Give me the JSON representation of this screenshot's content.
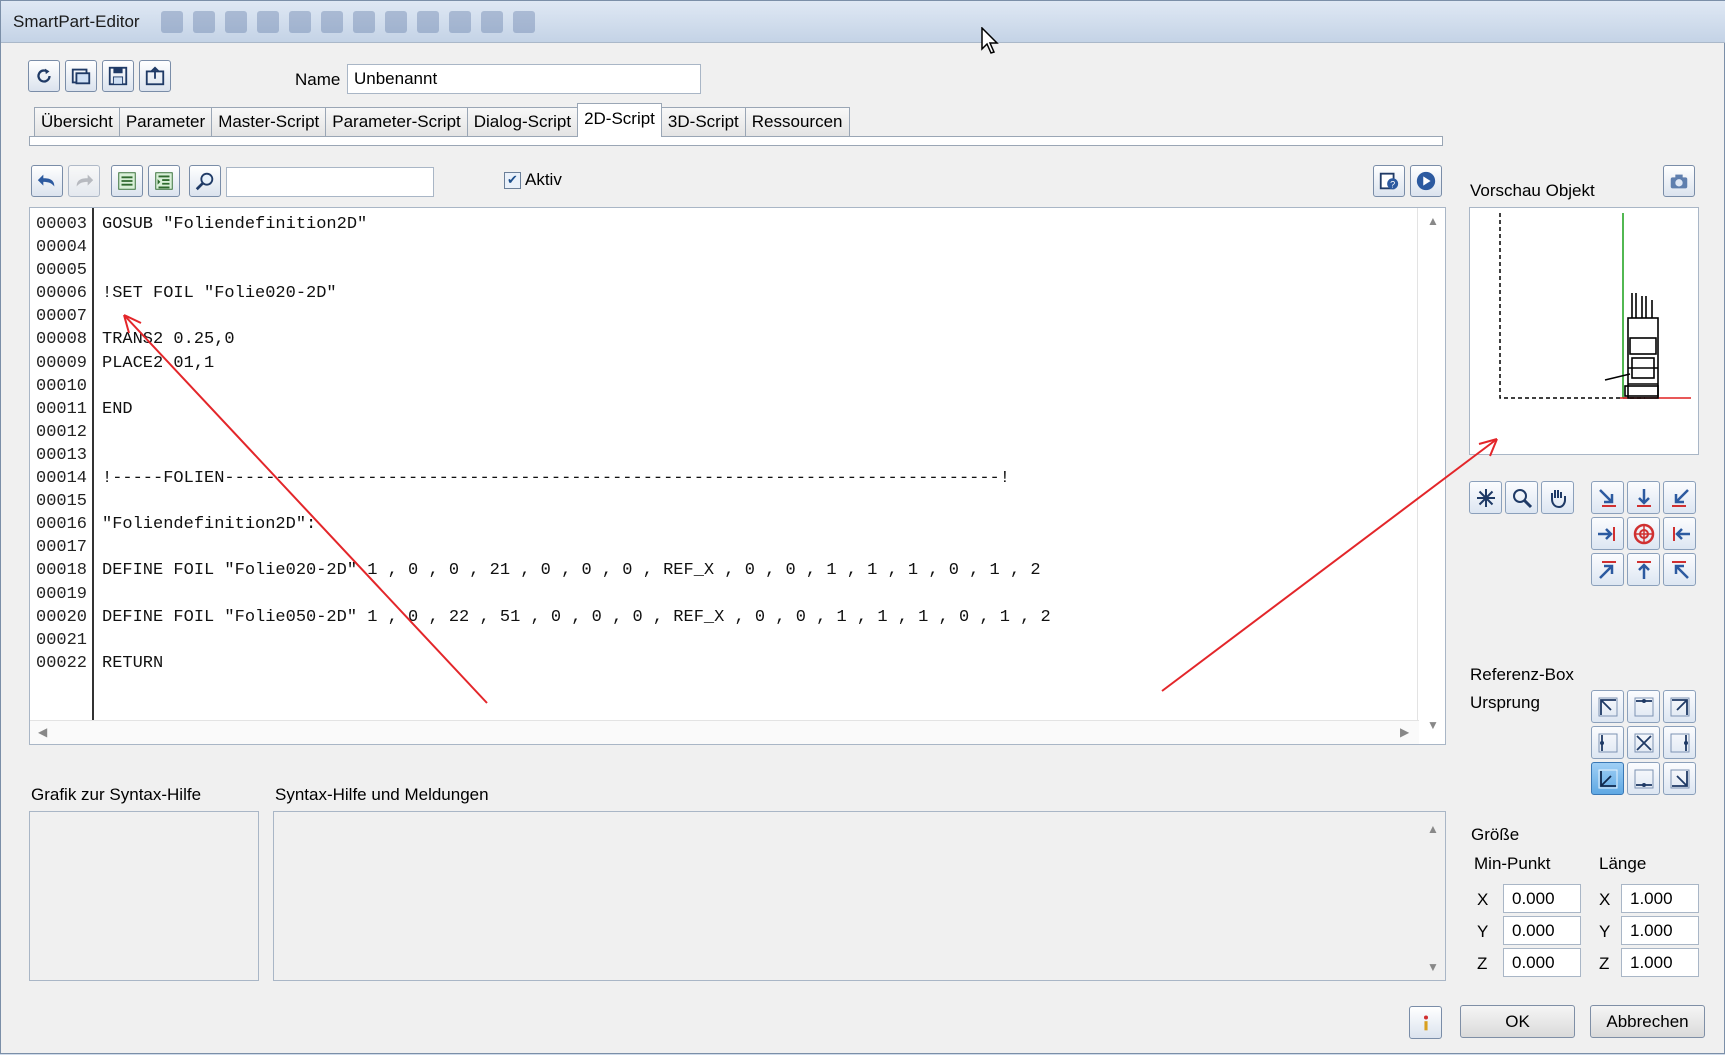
{
  "window": {
    "title": "SmartPart-Editor"
  },
  "header": {
    "name_label": "Name",
    "name_value": "Unbenannt"
  },
  "tabs": [
    {
      "label": "Übersicht",
      "active": false
    },
    {
      "label": "Parameter",
      "active": false
    },
    {
      "label": "Master-Script",
      "active": false
    },
    {
      "label": "Parameter-Script",
      "active": false
    },
    {
      "label": "Dialog-Script",
      "active": false
    },
    {
      "label": "2D-Script",
      "active": true
    },
    {
      "label": "3D-Script",
      "active": false
    },
    {
      "label": "Ressourcen",
      "active": false
    }
  ],
  "editor_toolbar": {
    "search_value": "",
    "aktiv_label": "Aktiv",
    "aktiv_checked": true
  },
  "editor": {
    "line_numbers": [
      "00003",
      "00004",
      "00005",
      "00006",
      "00007",
      "00008",
      "00009",
      "00010",
      "00011",
      "00012",
      "00013",
      "00014",
      "00015",
      "00016",
      "00017",
      "00018",
      "00019",
      "00020",
      "00021",
      "00022"
    ],
    "lines": [
      "GOSUB \"Foliendefinition2D\"",
      "",
      "",
      "!SET FOIL \"Folie020-2D\"",
      "",
      "TRANS2 0.25,0",
      "PLACE2 01,1",
      "",
      "END",
      "",
      "",
      "!-----FOLIEN----------------------------------------------------------------------------!",
      "",
      "\"Foliendefinition2D\":",
      "",
      "DEFINE FOIL \"Folie020-2D\" 1 , 0 , 0 , 21 , 0 , 0 , 0 , REF_X , 0 , 0 , 1 , 1 , 1 , 0 , 1 , 2",
      "",
      "DEFINE FOIL \"Folie050-2D\" 1 , 0 , 22 , 51 , 0 , 0 , 0 , REF_X , 0 , 0 , 1 , 1 , 1 , 0 , 1 , 2",
      "",
      "RETURN"
    ]
  },
  "bottom": {
    "graphic_label": "Grafik zur Syntax-Hilfe",
    "syntax_label": "Syntax-Hilfe und Meldungen"
  },
  "preview": {
    "label": "Vorschau Objekt"
  },
  "refbox": {
    "label": "Referenz-Box",
    "origin_label": "Ursprung"
  },
  "size": {
    "label": "Größe",
    "min_label": "Min-Punkt",
    "len_label": "Länge",
    "min": {
      "x": "0.000",
      "y": "0.000",
      "z": "0.000"
    },
    "len": {
      "x": "1.000",
      "y": "1.000",
      "z": "1.000"
    },
    "axis": {
      "x": "X",
      "y": "Y",
      "z": "Z"
    }
  },
  "footer": {
    "ok_label": "OK",
    "cancel_label": "Abbrechen"
  },
  "colors": {
    "annotation": "#e3262a",
    "accent": "#2f6fb8",
    "titlebar": "#cdd9e8"
  }
}
